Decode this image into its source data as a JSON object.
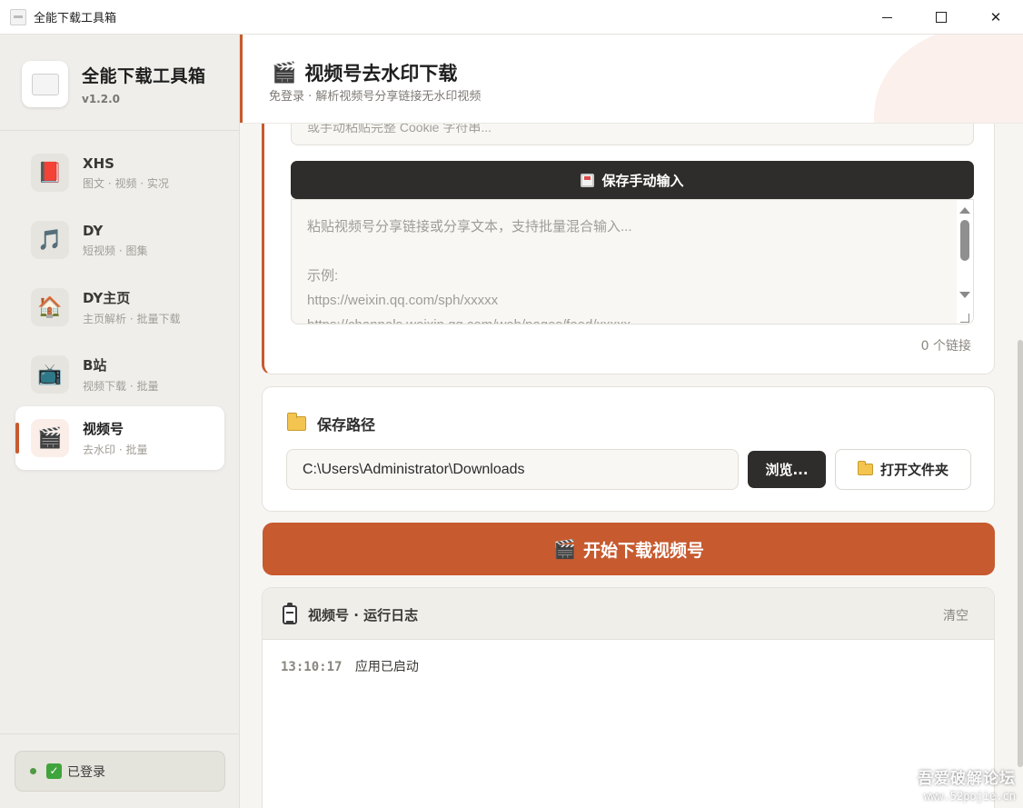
{
  "window": {
    "title": "全能下载工具箱",
    "controls": {
      "close": "✕"
    }
  },
  "brand": {
    "name": "全能下载工具箱",
    "version": "v1.2.0"
  },
  "nav": [
    {
      "icon": "book-icon",
      "emoji": "📕",
      "label": "XHS",
      "sub": "图文 · 视频 · 实况"
    },
    {
      "icon": "music-note-icon",
      "emoji": "🎵",
      "label": "DY",
      "sub": "短视频 · 图集"
    },
    {
      "icon": "house-icon",
      "emoji": "🏠",
      "label": "DY主页",
      "sub": "主页解析 · 批量下载"
    },
    {
      "icon": "tv-icon",
      "emoji": "📺",
      "label": "B站",
      "sub": "视频下载 · 批量"
    },
    {
      "icon": "clapper-icon",
      "emoji": "🎬",
      "label": "视频号",
      "sub": "去水印 · 批量",
      "active": true
    }
  ],
  "login": {
    "text": "已登录",
    "check": "✓"
  },
  "header": {
    "icon": "🎬",
    "title": "视频号去水印下载",
    "subtitle": "免登录 · 解析视频号分享链接无水印视频"
  },
  "cookie": {
    "placeholder": "或手动粘贴完整 Cookie 字符串..."
  },
  "save_manual": {
    "label": "保存手动输入"
  },
  "links": {
    "placeholder": "粘贴视频号分享链接或分享文本，支持批量混合输入...\n\n示例:\nhttps://weixin.qq.com/sph/xxxxx\nhttps://channels.weixin.qq.com/web/pages/feed/xxxxx",
    "count": "0 个链接"
  },
  "save_path": {
    "title": "保存路径",
    "value": "C:\\Users\\Administrator\\Downloads",
    "browse_label": "浏览...",
    "open_label": "打开文件夹"
  },
  "start": {
    "icon": "🎬",
    "label": "开始下载视频号"
  },
  "log": {
    "title": "视频号 · 运行日志",
    "clear_label": "清空",
    "entries": [
      {
        "time": "13:10:17",
        "text": "应用已启动"
      }
    ]
  },
  "watermark": {
    "line1": "吾爱破解论坛",
    "line2": "www.52pojie.cn"
  },
  "colors": {
    "accent": "#c75a2f",
    "dark_button": "#2e2d2b",
    "sidebar_bg": "#efeeea",
    "success": "#4f9a45"
  }
}
